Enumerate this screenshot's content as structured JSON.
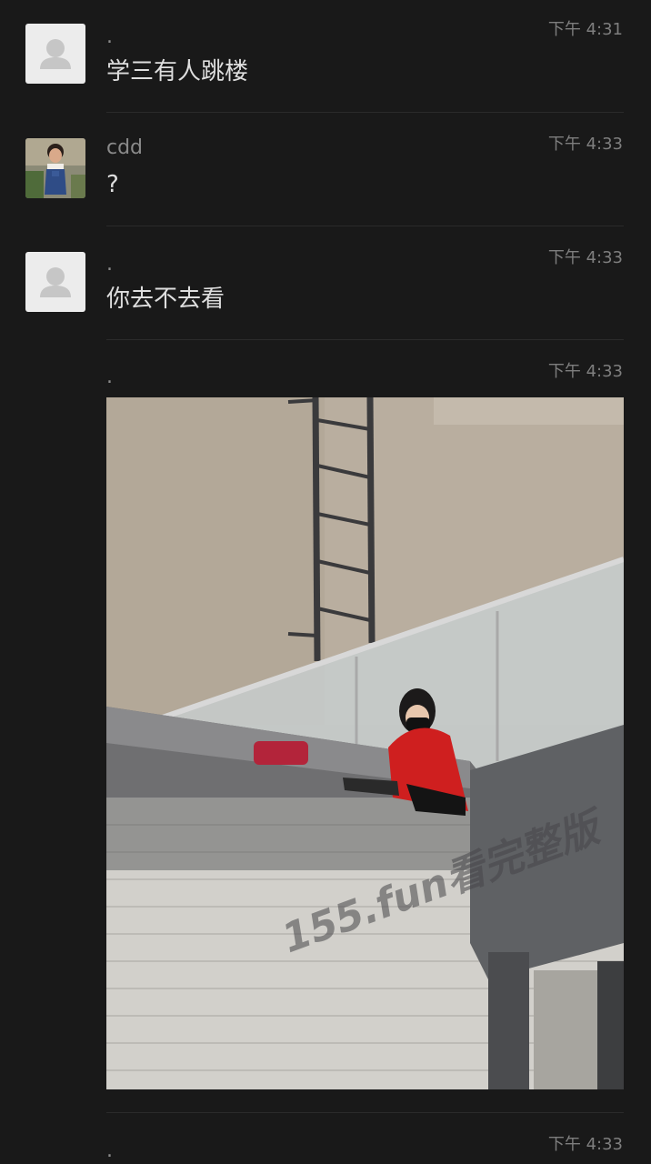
{
  "messages": [
    {
      "sender": ".",
      "time": "下午 4:31",
      "text": "学三有人跳楼",
      "avatar": "default-avatar"
    },
    {
      "sender": "cdd",
      "time": "下午 4:33",
      "text": "?",
      "avatar": "child-photo-avatar"
    },
    {
      "sender": ".",
      "time": "下午 4:33",
      "text": "你去不去看",
      "avatar": "default-avatar"
    },
    {
      "sender": ".",
      "time": "下午 4:33",
      "image": "rooftop-photo",
      "watermark": "155.fun看完整版",
      "avatar": "none"
    },
    {
      "sender": ".",
      "time": "下午 4:33",
      "avatar": "none"
    }
  ],
  "colors": {
    "background": "#191919",
    "text": "#dedede",
    "meta": "#8a8a8a"
  }
}
